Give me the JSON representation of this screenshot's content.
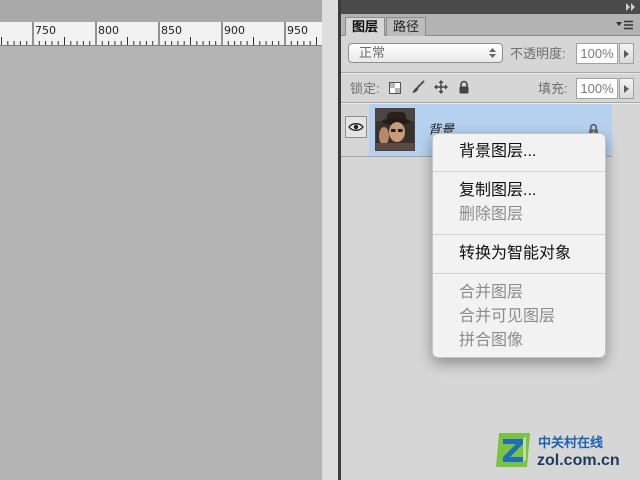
{
  "canvas": {
    "ruler": {
      "unit_labels": [
        "750",
        "800",
        "850",
        "900",
        "950"
      ]
    }
  },
  "layers_panel": {
    "tabs": [
      {
        "label": "图层",
        "active": true
      },
      {
        "label": "路径",
        "active": false
      }
    ],
    "blend_mode": {
      "value": "正常"
    },
    "opacity": {
      "label": "不透明度:",
      "value": "100%"
    },
    "lock": {
      "label": "锁定:",
      "icons": [
        "lock-transparent-pixels-icon",
        "lock-image-pixels-icon",
        "lock-position-icon",
        "lock-all-icon"
      ]
    },
    "fill": {
      "label": "填充:",
      "value": "100%"
    },
    "layers": [
      {
        "name": "背景",
        "visible": true,
        "locked": true,
        "selected": true
      }
    ]
  },
  "context_menu": {
    "items": [
      {
        "label": "背景图层...",
        "enabled": true
      },
      {
        "label": "复制图层...",
        "enabled": true
      },
      {
        "label": "删除图层",
        "enabled": false
      },
      {
        "label": "转换为智能对象",
        "enabled": true
      },
      {
        "label": "合并图层",
        "enabled": false
      },
      {
        "label": "合并可见图层",
        "enabled": false
      },
      {
        "label": "拼合图像",
        "enabled": false
      }
    ]
  },
  "watermark": {
    "name": "中关村在线",
    "domain": "zol.com.cn"
  },
  "colors": {
    "canvas_bg": "#b4b4b4",
    "panel_bg": "#d6d6d6",
    "selected_layer": "#b5d1ef",
    "menu_bg": "#f2f2f2",
    "menu_text": "#111111",
    "menu_text_disabled": "#8c8c8c",
    "watermark_blue": "#1b63b0",
    "logo_green": "#7bc142"
  },
  "icons": {
    "collapse": "double-chevron-right-icon",
    "panel_menu": "panel-menu-icon",
    "visibility": "eye-icon",
    "layer_lock": "lock-icon",
    "select_arrows": "updown-arrows-icon",
    "slider_arrow": "triangle-right-icon",
    "logo": "zol-logo-icon"
  }
}
